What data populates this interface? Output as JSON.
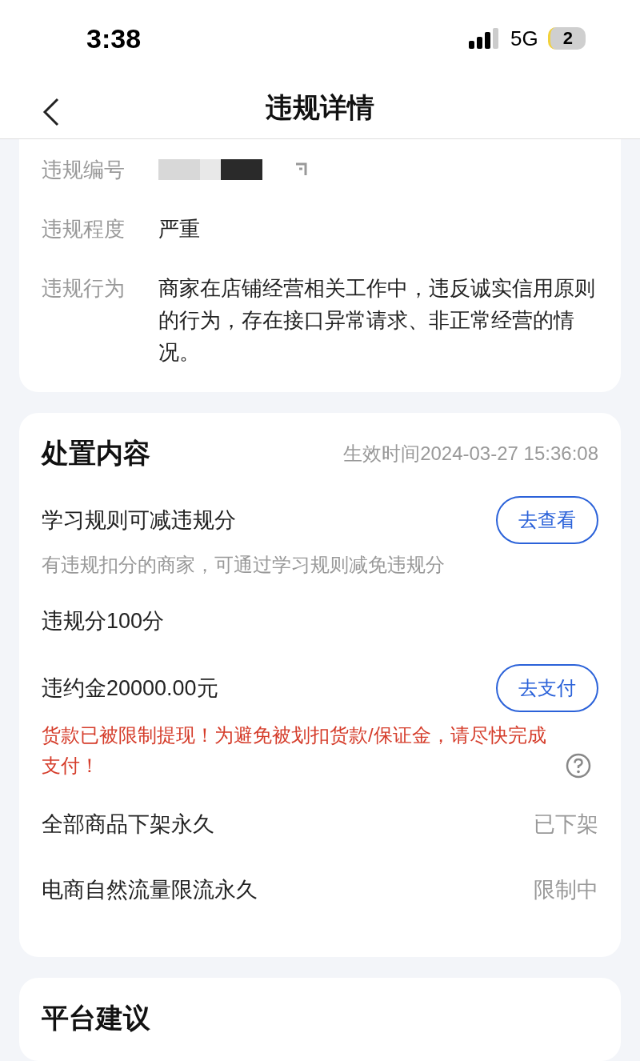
{
  "status_bar": {
    "time": "3:38",
    "network": "5G",
    "battery": "2"
  },
  "header": {
    "title": "违规详情"
  },
  "violation": {
    "rows": [
      {
        "kind": "redacted",
        "label": "违规编号"
      },
      {
        "kind": "text",
        "label": "违规程度",
        "value": "严重"
      },
      {
        "kind": "text",
        "label": "违规行为",
        "value": "商家在店铺经营相关工作中，违反诚实信用原则的行为，存在接口异常请求、非正常经营的情况。"
      }
    ]
  },
  "measures": {
    "title": "处置内容",
    "effective_time": "生效时间2024-03-27 15:36:08",
    "items": [
      {
        "title": "学习规则可减违规分",
        "button": "去查看",
        "note": "有违规扣分的商家，可通过学习规则减免违规分"
      },
      {
        "title": "违规分100分"
      },
      {
        "title": "违约金20000.00元",
        "button": "去支付",
        "warning": "货款已被限制提现！为避免被划扣货款/保证金，请尽快完成支付！"
      },
      {
        "title": "全部商品下架永久",
        "status": "已下架"
      },
      {
        "title": "电商自然流量限流永久",
        "status": "限制中"
      }
    ]
  },
  "advice": {
    "title": "平台建议"
  }
}
